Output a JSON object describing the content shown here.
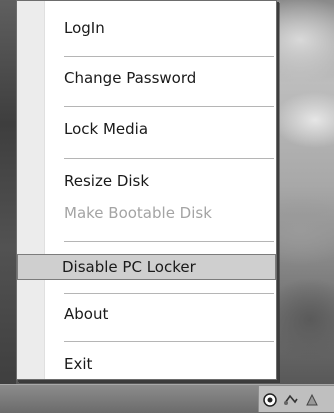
{
  "menu": {
    "items": {
      "login": "LogIn",
      "change_password": "Change Password",
      "lock_media": "Lock Media",
      "resize_disk": "Resize Disk",
      "make_bootable_disk": "Make Bootable Disk",
      "disable_pc_locker": "Disable PC Locker",
      "about": "About",
      "exit": "Exit"
    },
    "disabled": [
      "Make Bootable Disk"
    ],
    "highlighted": "Disable PC Locker"
  },
  "tray": {
    "icons": [
      "app-tray-icon",
      "network-tray-icon",
      "tray-icon"
    ]
  },
  "colors": {
    "menu_background": "#ffffff",
    "gutter": "#ececec",
    "highlight": "#cfcfcf",
    "disabled_text": "#a4a4a4"
  }
}
